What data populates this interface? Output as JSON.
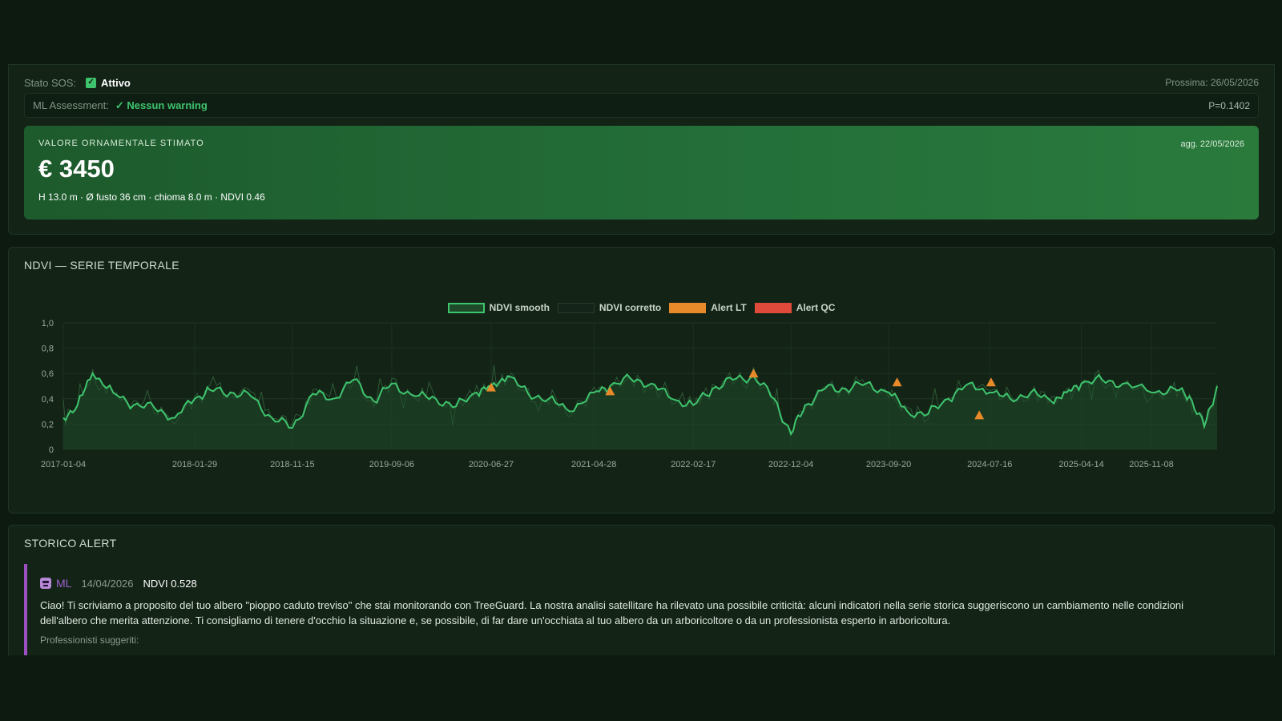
{
  "status": {
    "sos_label": "Stato SOS:",
    "sos_value": "Attivo",
    "next_check": "Prossima: 26/05/2026",
    "ml_label": "ML Assessment:",
    "ml_value": "✓ Nessun warning",
    "ml_probability": "P=0.1402"
  },
  "valuation": {
    "label": "VALORE ORNAMENTALE STIMATO",
    "updated": "agg. 22/05/2026",
    "amount": "€ 3450",
    "details": "H 13.0 m · Ø fusto 36 cm · chioma 8.0 m · NDVI 0.46"
  },
  "ndvi_section": {
    "title": "NDVI — SERIE TEMPORALE"
  },
  "chart_data": {
    "type": "line",
    "title": "",
    "legend": [
      "NDVI smooth",
      "NDVI corretto",
      "Alert LT",
      "Alert QC"
    ],
    "legend_position": "top-center",
    "ylim": [
      0,
      1.0
    ],
    "yticks": [
      "1,0",
      "0,8",
      "0,6",
      "0,4",
      "0,2",
      "0"
    ],
    "xticks": [
      "2017-01-04",
      "2018-01-29",
      "2018-11-15",
      "2019-09-06",
      "2020-06-27",
      "2021-04-28",
      "2022-02-17",
      "2022-12-04",
      "2023-09-20",
      "2024-07-16",
      "2025-04-14",
      "2025-11-08"
    ],
    "grid": true,
    "colors": {
      "smooth": "#3ec46d",
      "corretto": "#2e5a36",
      "alert_lt": "#e8892a",
      "alert_qc": "#e04a3a"
    },
    "series": [
      {
        "name": "NDVI smooth",
        "x": [
          "2017-01-04",
          "2017-02-15",
          "2017-04-01",
          "2017-06-01",
          "2017-08-01",
          "2017-10-01",
          "2017-12-01",
          "2018-01-29",
          "2018-03-15",
          "2018-05-15",
          "2018-07-15",
          "2018-09-15",
          "2018-11-15",
          "2019-01-15",
          "2019-03-15",
          "2019-05-15",
          "2019-07-15",
          "2019-09-06",
          "2019-11-15",
          "2020-01-15",
          "2020-03-15",
          "2020-05-15",
          "2020-06-27",
          "2020-08-15",
          "2020-10-15",
          "2020-12-15",
          "2021-02-15",
          "2021-04-28",
          "2021-06-15",
          "2021-08-15",
          "2021-10-15",
          "2021-12-15",
          "2022-02-17",
          "2022-04-15",
          "2022-06-15",
          "2022-08-15",
          "2022-10-15",
          "2022-12-04",
          "2023-01-15",
          "2023-03-15",
          "2023-05-15",
          "2023-07-15",
          "2023-09-20",
          "2023-11-15",
          "2024-01-15",
          "2024-03-15",
          "2024-05-15",
          "2024-07-16",
          "2024-09-15",
          "2024-11-15",
          "2025-01-15",
          "2025-03-01",
          "2025-04-14",
          "2025-06-15",
          "2025-08-15",
          "2025-11-08",
          "2026-01-15",
          "2026-03-01",
          "2026-04-14",
          "2026-05-22"
        ],
        "values": [
          0.25,
          0.35,
          0.6,
          0.45,
          0.35,
          0.33,
          0.25,
          0.4,
          0.47,
          0.45,
          0.42,
          0.25,
          0.17,
          0.44,
          0.4,
          0.55,
          0.38,
          0.52,
          0.42,
          0.4,
          0.34,
          0.45,
          0.5,
          0.58,
          0.44,
          0.4,
          0.3,
          0.45,
          0.5,
          0.56,
          0.52,
          0.4,
          0.35,
          0.48,
          0.55,
          0.58,
          0.4,
          0.12,
          0.35,
          0.48,
          0.48,
          0.52,
          0.45,
          0.3,
          0.28,
          0.4,
          0.52,
          0.45,
          0.4,
          0.45,
          0.38,
          0.45,
          0.52,
          0.55,
          0.52,
          0.45,
          0.48,
          0.42,
          0.18,
          0.5
        ]
      },
      {
        "name": "NDVI corretto",
        "note_raw_noisy": true
      }
    ],
    "alerts_lt": [
      {
        "x": "2020-06-27",
        "y": 0.49
      },
      {
        "x": "2021-06-15",
        "y": 0.46
      },
      {
        "x": "2022-08-15",
        "y": 0.6
      },
      {
        "x": "2023-10-15",
        "y": 0.53
      },
      {
        "x": "2024-06-15",
        "y": 0.27
      },
      {
        "x": "2024-07-20",
        "y": 0.53
      }
    ]
  },
  "alerts_section": {
    "title": "STORICO ALERT",
    "items": [
      {
        "source": "ML",
        "date": "14/04/2026",
        "ndvi": "NDVI 0.528",
        "message": "Ciao! Ti scriviamo a proposito del tuo albero \"pioppo caduto treviso\" che stai monitorando con TreeGuard. La nostra analisi satellitare ha rilevato una possibile criticità: alcuni indicatori nella serie storica suggeriscono un cambiamento nelle condizioni dell'albero che merita attenzione. Ti consigliamo di tenere d'occhio la situazione e, se possibile, di far dare un'occhiata al tuo albero da un arboricoltore o da un professionista esperto in arboricoltura.",
        "suggested_label": "Professionisti suggeriti:"
      }
    ]
  }
}
